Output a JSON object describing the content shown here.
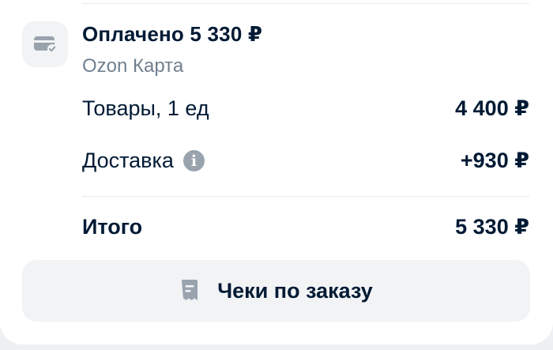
{
  "payment": {
    "title": "Оплачено 5 330 ₽",
    "method": "Ozon Карта",
    "icon": "card-check-icon"
  },
  "summary": {
    "goods_label": "Товары, 1 ед",
    "goods_value": "4 400 ₽",
    "delivery_label": "Доставка",
    "delivery_value": "+930 ₽",
    "delivery_info_icon": "info-icon",
    "total_label": "Итого",
    "total_value": "5 330 ₽"
  },
  "receipts": {
    "label": "Чеки по заказу",
    "icon": "receipt-icon"
  },
  "colors": {
    "text": "#001a34",
    "muted": "#707f8d",
    "icon_gray": "#99a3ae",
    "button_bg": "#f2f3f5",
    "page_bg": "#eef0f3"
  }
}
